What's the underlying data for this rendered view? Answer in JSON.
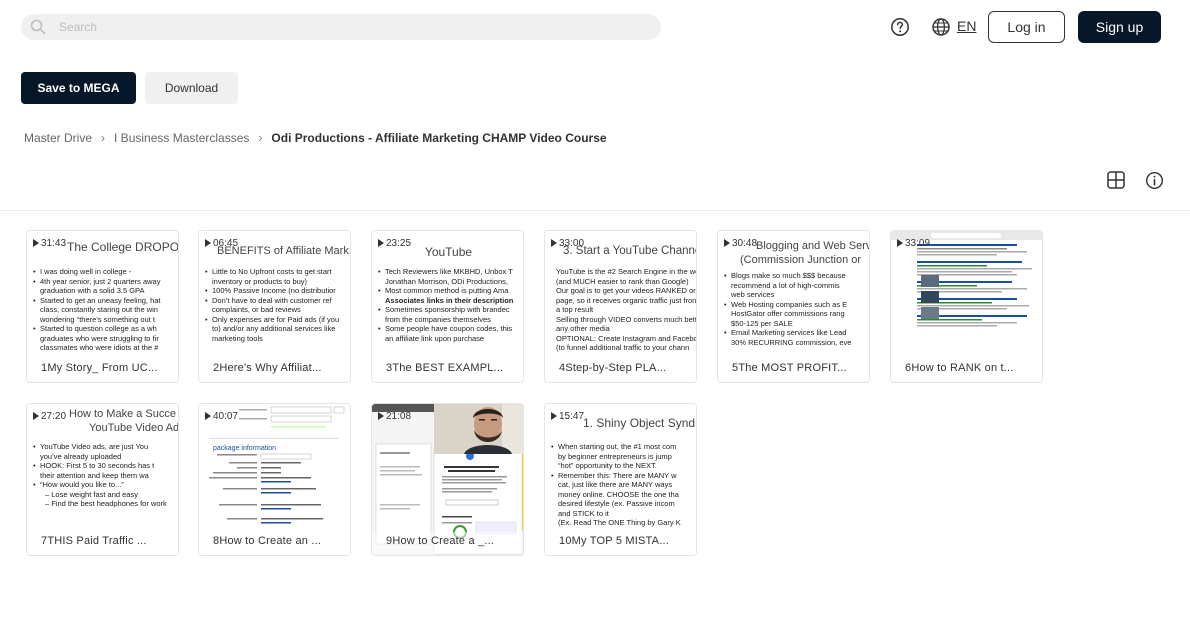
{
  "search": {
    "placeholder": "Search"
  },
  "header": {
    "language": "EN",
    "login_label": "Log in",
    "signup_label": "Sign up"
  },
  "actions": {
    "save_label": "Save to MEGA",
    "download_label": "Download"
  },
  "breadcrumb": [
    "Master Drive",
    "I Business Masterclasses",
    "Odi Productions - Affiliate Marketing CHAMP Video Course"
  ],
  "colors": {
    "primary": "#06172a",
    "secondary_bg": "#f0f0f0",
    "text": "#303233",
    "highlight_yellow": "#f5d31f",
    "link_blue": "#1a4fa0"
  },
  "files": [
    {
      "duration": "31:43",
      "name": "1My Story_ From UC...",
      "slide_title": "The College DROPO",
      "bullets": [
        "I was doing well in college -",
        "4th year senior, just 2 quarters away",
        "graduation with a solid 3.5 GPA",
        "Started to get an uneasy feeling, hat",
        "class, constantly staring out the win",
        "wondering “there’s something out t",
        "Started to question college as a wh",
        "graduates who were struggling to fir",
        "classmates who were idiots at the #"
      ]
    },
    {
      "duration": "06:45",
      "name": "2Here's Why Affiliat...",
      "slide_title": "BENEFITS of Affiliate Mark",
      "bullets": [
        "Little to No Upfront costs to get start",
        "inventory or products to buy)",
        "100% Passive Income (no distributior",
        "Don’t have to deal with customer ref",
        "complaints, or bad reviews",
        "Only expenses are for Paid ads (if you",
        "to) and/or any additional services like",
        "marketing tools"
      ]
    },
    {
      "duration": "23:25",
      "name": "3The BEST EXAMPL...",
      "slide_title": "YouTube",
      "bullets": [
        "Tech Reviewers like MKBHD, Unbox T",
        "Jonathan Morrison, ODi Productions,",
        "Most common method is putting Ama",
        "Associates links in their description",
        "Sometimes sponsorship with brandec",
        "from the companies themselves",
        "Some people have coupon codes, this",
        "an affiliate link upon purchase"
      ]
    },
    {
      "duration": "33:00",
      "name": "4Step-by-Step PLA...",
      "slide_title": "3. Start a YouTube Channe",
      "bullets": [
        "YouTube is the #2 Search Engine in the wo",
        "(and MUCH easier to rank than Google)",
        "Our goal is to get your videos RANKED on t",
        "page, so it receives organic traffic just fron",
        "a top result",
        "Selling through VIDEO converts much bett",
        "any other media",
        "OPTIONAL: Create Instagram and Faceboo",
        "(to funnel additional traffic to your chann"
      ]
    },
    {
      "duration": "30:48",
      "name": "5The MOST PROFIT...",
      "slide_title": "Blogging and Web Serv",
      "slide_sub": "(Commission Junction or",
      "bullets": [
        "Blogs make so much $$$ because",
        "recommend a lot of high-commis",
        "web services",
        "Web Hosting companies such as E",
        "HostGator offer commissions rang",
        "$50-125 per SALE",
        "Email Marketing services like Lead",
        "30% RECURRING commission, eve"
      ]
    },
    {
      "duration": "33:09",
      "name": "6How to RANK on t..."
    },
    {
      "duration": "27:20",
      "name": "7THIS Paid Traffic ...",
      "slide_title": "How to Make a Succe",
      "slide_sub": "YouTube Video Ad",
      "bullets": [
        "YouTube Video ads, are just You",
        "you’ve already uploaded",
        "HOOK: First 5 to 30 seconds has t",
        "their attention and keep them wa",
        "“How would you like to...”",
        "– Lose weight fast and easy",
        "– Find the best headphones for work"
      ]
    },
    {
      "duration": "40:07",
      "name": "8How to Create an ...",
      "form_heading": "package information"
    },
    {
      "duration": "21:08",
      "name": "9How to Create a _..."
    },
    {
      "duration": "15:47",
      "name": "10My TOP 5 MISTA...",
      "slide_title": "1. Shiny Object Synd",
      "bullets": [
        "When starting out, the #1 most com",
        "by beginner entrepreneurs is jump",
        "“hot” opportunity to the NEXT.",
        "Remember this: There are MANY w",
        "cat, just like there are MANY ways",
        "money online. CHOOSE the one tha",
        "desired lifestyle (ex. Passive incom",
        "and STICK to it",
        "(Ex. Read The ONE Thing by Gary K"
      ]
    }
  ]
}
